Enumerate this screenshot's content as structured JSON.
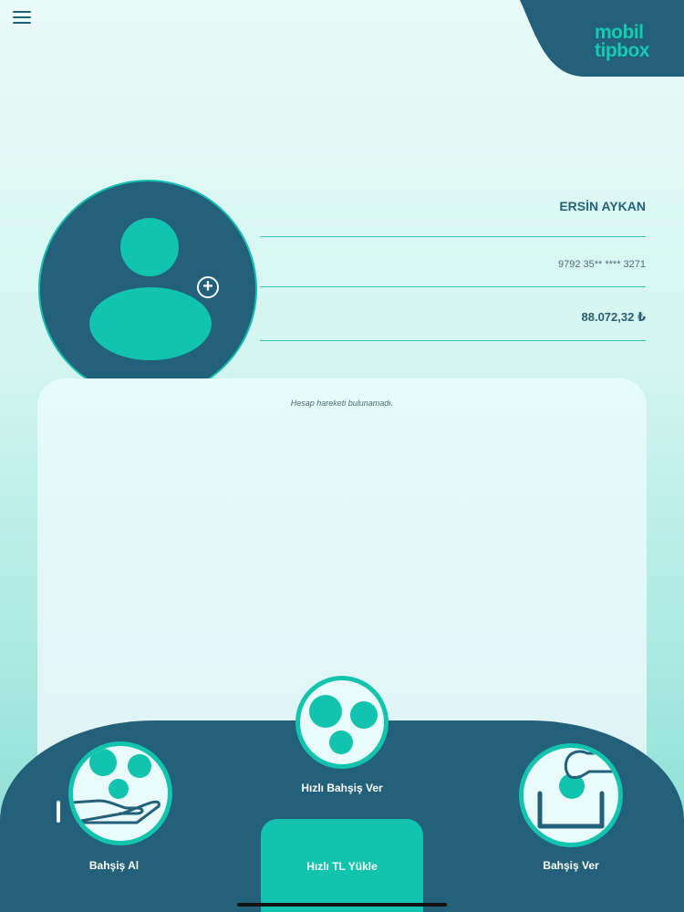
{
  "header": {
    "menu_icon": "hamburger-menu-icon",
    "logo_line1": "mobil",
    "logo_line2": "tipbox",
    "logo_color": "#15cbb1",
    "brand_dark": "#23607a"
  },
  "profile": {
    "name": "ERSİN AYKAN",
    "card_number": "9792 35** **** 3271",
    "balance": "88.072,32 ₺",
    "avatar_icon": "user-avatar-icon",
    "add_photo_icon": "add-circle-icon"
  },
  "transactions": {
    "empty_message": "Hesap hareketi bulunamadı."
  },
  "actions": {
    "quick_tip": "Hızlı Bahşiş Ver",
    "receive_tip": "Bahşiş Al",
    "give_tip": "Bahşiş Ver",
    "quick_load": "Hızlı TL Yükle"
  },
  "colors": {
    "accent": "#12c4ad",
    "dark": "#23607a"
  }
}
